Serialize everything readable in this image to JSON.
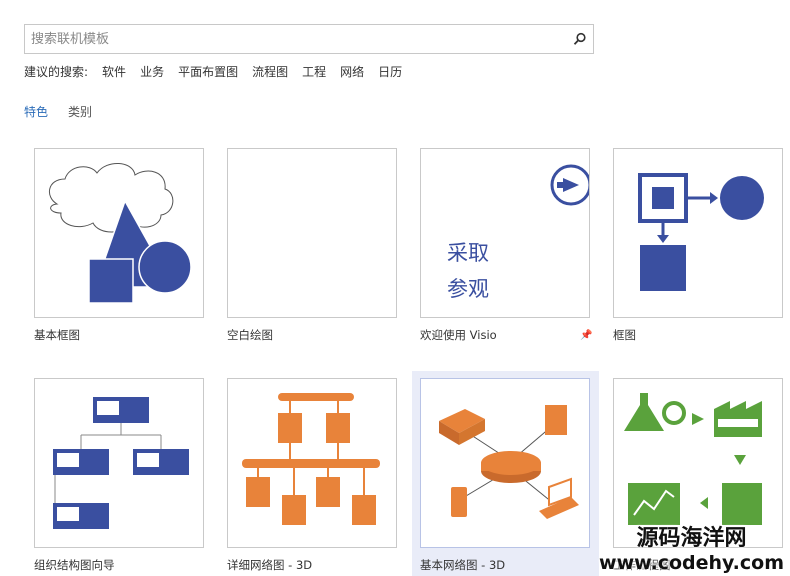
{
  "search": {
    "placeholder": "搜索联机模板"
  },
  "suggested": {
    "label": "建议的搜索:",
    "links": [
      "软件",
      "业务",
      "平面布置图",
      "流程图",
      "工程",
      "网络",
      "日历"
    ]
  },
  "tabs": [
    {
      "label": "特色",
      "active": true
    },
    {
      "label": "类别",
      "active": false
    }
  ],
  "templates": [
    {
      "caption": "基本框图"
    },
    {
      "caption": "空白绘图"
    },
    {
      "caption": "欢迎使用 Visio",
      "thumb_text": [
        "采取",
        "参观"
      ]
    },
    {
      "caption": "框图"
    },
    {
      "caption": "组织结构图向导"
    },
    {
      "caption": "详细网络图 - 3D"
    },
    {
      "caption": "基本网络图 - 3D",
      "selected": true
    },
    {
      "caption": "工作流程图"
    }
  ],
  "colors": {
    "accent": "#2b6cb8",
    "shape_blue": "#3a4fa0",
    "network_orange": "#e8833a",
    "workflow_green": "#5aa23c"
  },
  "watermark": {
    "line1": "源码海洋网",
    "line2": "www.codehy.com"
  }
}
